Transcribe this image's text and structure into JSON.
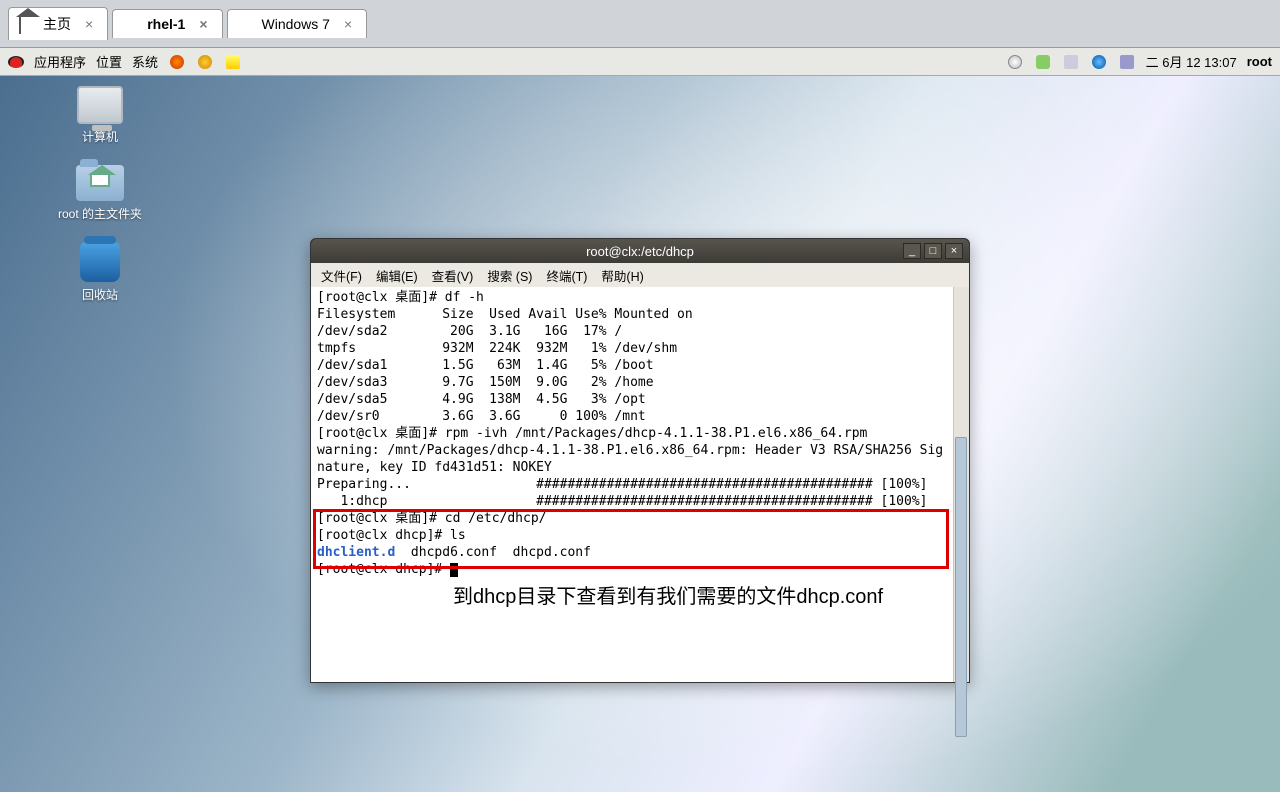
{
  "hostTabs": {
    "home": "主页",
    "rhel": "rhel-1",
    "win": "Windows 7"
  },
  "guestTop": {
    "apps": "应用程序",
    "places": "位置",
    "system": "系统",
    "date": "二 6月 12 13:07",
    "user": "root"
  },
  "desktop": {
    "computer": "计算机",
    "homeFolder": "root 的主文件夹",
    "trash": "回收站"
  },
  "terminal": {
    "title": "root@clx:/etc/dhcp",
    "menu": {
      "file": "文件(F)",
      "edit": "编辑(E)",
      "view": "查看(V)",
      "search": "搜索 (S)",
      "term": "终端(T)",
      "help": "帮助(H)"
    },
    "lines": {
      "l1": "[root@clx 桌面]# df -h",
      "l2": "Filesystem      Size  Used Avail Use% Mounted on",
      "l3": "/dev/sda2        20G  3.1G   16G  17% /",
      "l4": "tmpfs           932M  224K  932M   1% /dev/shm",
      "l5": "/dev/sda1       1.5G   63M  1.4G   5% /boot",
      "l6": "/dev/sda3       9.7G  150M  9.0G   2% /home",
      "l7": "/dev/sda5       4.9G  138M  4.5G   3% /opt",
      "l8": "/dev/sr0        3.6G  3.6G     0 100% /mnt",
      "l9": "[root@clx 桌面]# rpm -ivh /mnt/Packages/dhcp-4.1.1-38.P1.el6.x86_64.rpm",
      "l10": "warning: /mnt/Packages/dhcp-4.1.1-38.P1.el6.x86_64.rpm: Header V3 RSA/SHA256 Sig",
      "l11": "nature, key ID fd431d51: NOKEY",
      "l12": "Preparing...                ########################################### [100%]",
      "l13": "   1:dhcp                   ########################################### [100%]",
      "l14": "[root@clx 桌面]# cd /etc/dhcp/",
      "l15": "[root@clx dhcp]# ls",
      "l16a": "dhclient.d",
      "l16b": "  dhcpd6.conf  dhcpd.conf",
      "l17": "[root@clx dhcp]# "
    },
    "annotation": "到dhcp目录下查看到有我们需要的文件dhcp.conf"
  }
}
